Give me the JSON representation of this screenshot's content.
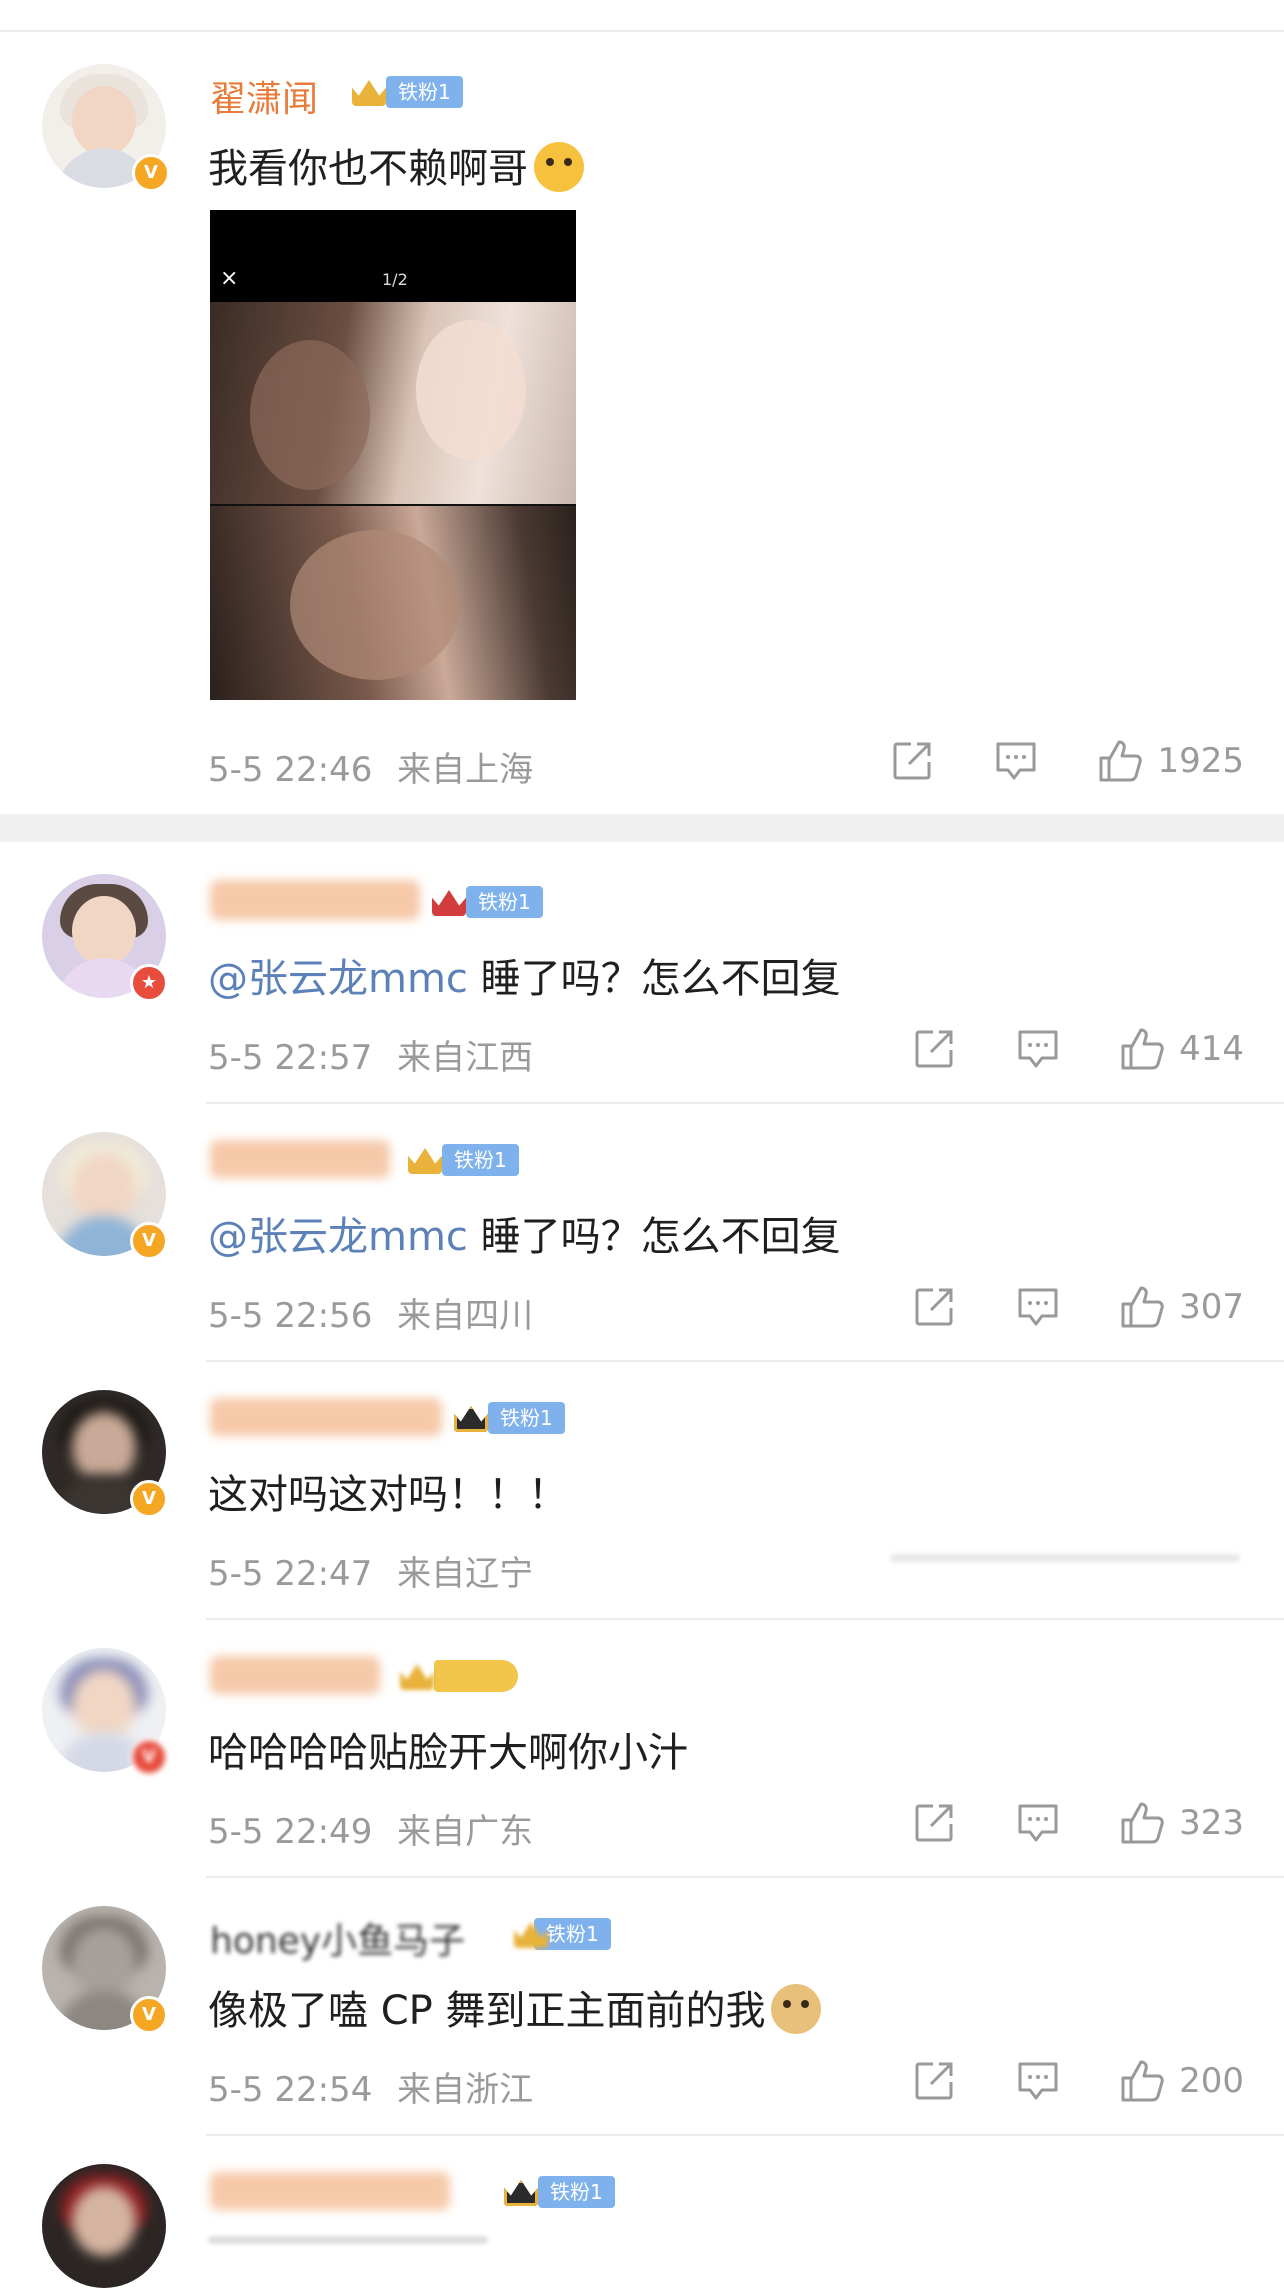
{
  "comments": [
    {
      "username": "翟潇闻",
      "fan_badge": "铁粉1",
      "text": "我看你也不赖啊哥",
      "emoji": "cover-face-emoji",
      "image": {
        "close": "×",
        "pager": "1/2"
      },
      "time": "5-5 22:46",
      "location": "来自上海",
      "likes": "1925"
    },
    {
      "username": "",
      "fan_badge": "铁粉1",
      "mention": "@张云龙mmc",
      "text": " 睡了吗？怎么不回复",
      "time": "5-5 22:57",
      "location": "来自江西",
      "likes": "414"
    },
    {
      "username": "",
      "fan_badge": "铁粉1",
      "mention": "@张云龙mmc",
      "text": " 睡了吗？怎么不回复",
      "time": "5-5 22:56",
      "location": "来自四川",
      "likes": "307"
    },
    {
      "username": "",
      "fan_badge": "铁粉1",
      "text": "这对吗这对吗！！！",
      "time": "5-5 22:47",
      "location": "来自辽宁",
      "likes": ""
    },
    {
      "username": "",
      "fan_badge": "",
      "text": "哈哈哈哈贴脸开大啊你小汁",
      "time": "5-5 22:49",
      "location": "来自广东",
      "likes": "323"
    },
    {
      "username": "honey小鱼马子",
      "fan_badge": "铁粉1",
      "text": "像极了嗑 CP 舞到正主面前的我",
      "emoji": "doge-emoji",
      "time": "5-5 22:54",
      "location": "来自浙江",
      "likes": "200"
    },
    {
      "username": "",
      "fan_badge": "铁粉1"
    }
  ],
  "icons": [
    "repost-icon",
    "comment-icon",
    "like-icon"
  ],
  "colors": {
    "username": "#e87b3a",
    "mention": "#5b81b8",
    "badge": "#7fb2ec",
    "meta": "#9a9a9a"
  }
}
